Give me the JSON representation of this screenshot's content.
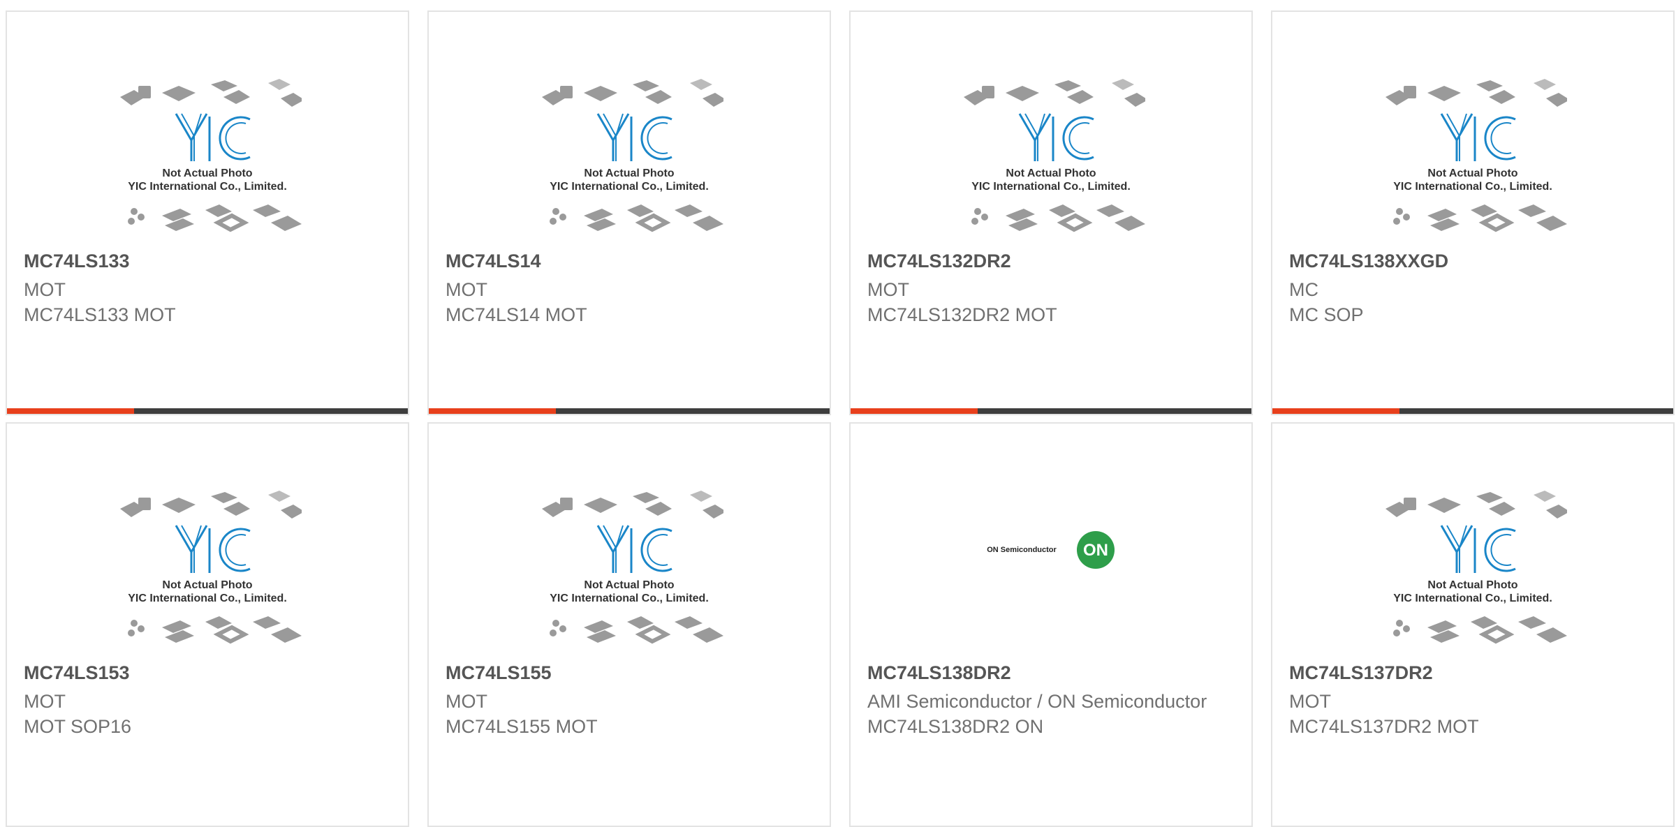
{
  "products": [
    {
      "part": "MC74LS133",
      "manufacturer": "MOT",
      "desc": "MC74LS133 MOT",
      "image": "yic-placeholder-icon"
    },
    {
      "part": "MC74LS14",
      "manufacturer": "MOT",
      "desc": "MC74LS14 MOT",
      "image": "yic-placeholder-icon"
    },
    {
      "part": "MC74LS132DR2",
      "manufacturer": "MOT",
      "desc": "MC74LS132DR2 MOT",
      "image": "yic-placeholder-icon"
    },
    {
      "part": "MC74LS138XXGD",
      "manufacturer": "MC",
      "desc": "MC SOP",
      "image": "yic-placeholder-icon"
    },
    {
      "part": "MC74LS153",
      "manufacturer": "MOT",
      "desc": "MOT SOP16",
      "image": "yic-placeholder-icon"
    },
    {
      "part": "MC74LS155",
      "manufacturer": "MOT",
      "desc": "MC74LS155 MOT",
      "image": "yic-placeholder-icon"
    },
    {
      "part": "MC74LS138DR2",
      "manufacturer": "AMI Semiconductor / ON Semiconductor",
      "desc": "MC74LS138DR2 ON",
      "image": "on-semiconductor-logo"
    },
    {
      "part": "MC74LS137DR2",
      "manufacturer": "MOT",
      "desc": "MC74LS137DR2 MOT",
      "image": "yic-placeholder-icon"
    }
  ],
  "placeholder": {
    "line1": "Not Actual Photo",
    "line2": "YIC International Co., Limited."
  },
  "on_logo": {
    "text": "ON Semiconductor",
    "mark": "ON"
  },
  "colors": {
    "accent": "#e8401c",
    "bar_dark": "#3e3e3e",
    "yic_blue": "#1a86c8",
    "on_green": "#2e9e4a"
  }
}
